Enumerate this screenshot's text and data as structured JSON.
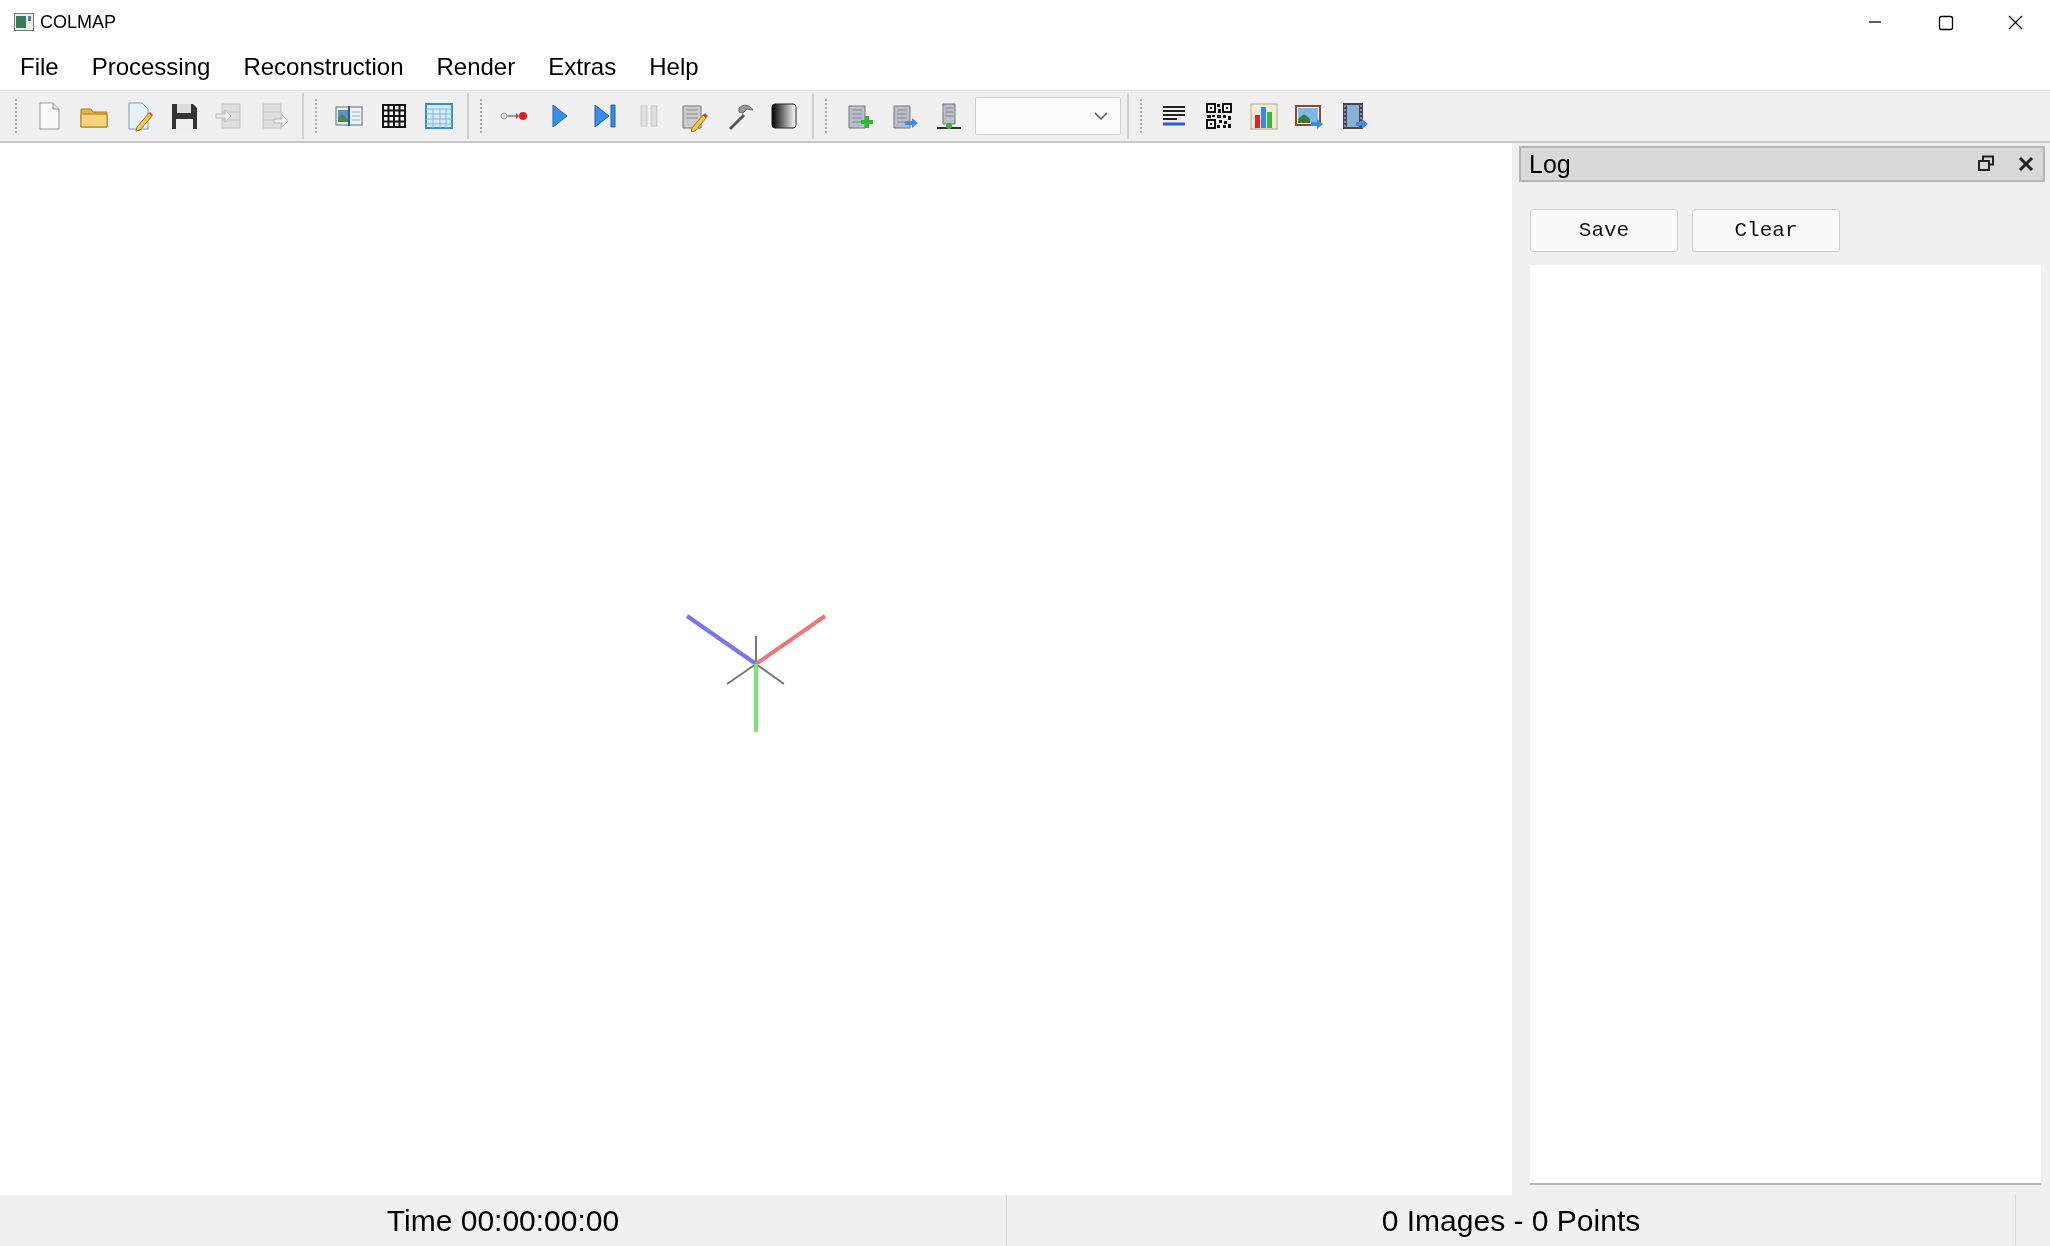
{
  "window": {
    "title": "COLMAP"
  },
  "menu": [
    "File",
    "Processing",
    "Reconstruction",
    "Render",
    "Extras",
    "Help"
  ],
  "toolbar": {
    "groups": [
      [
        {
          "disabled": false
        },
        {
          "disabled": false
        },
        {
          "disabled": false
        },
        {
          "disabled": false
        },
        {
          "disabled": true
        },
        {
          "disabled": true
        }
      ],
      [
        {
          "disabled": false
        },
        {
          "disabled": false
        },
        {
          "disabled": false
        }
      ],
      [
        {
          "disabled": false
        },
        {
          "disabled": false
        },
        {
          "disabled": false
        },
        {
          "disabled": true
        },
        {
          "disabled": false
        },
        {
          "disabled": false
        },
        {
          "disabled": false
        }
      ],
      [
        {
          "disabled": false
        },
        {
          "disabled": false
        },
        {
          "disabled": false
        }
      ],
      [
        {
          "disabled": false
        },
        {
          "disabled": false
        },
        {
          "disabled": false
        },
        {
          "disabled": false
        },
        {
          "disabled": false
        }
      ]
    ]
  },
  "log": {
    "title": "Log",
    "buttons": [
      "Save",
      "Clear"
    ]
  },
  "status_bar": {
    "time": "Time 00:00:00:00",
    "counts": "0 Images - 0 Points"
  }
}
